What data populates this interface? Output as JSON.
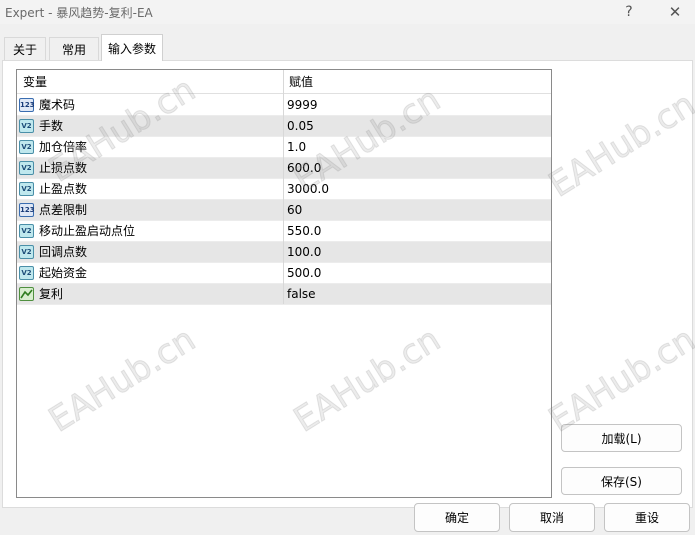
{
  "window": {
    "title": "Expert - 暴风趋势-复利-EA",
    "help": "?",
    "close": "✕"
  },
  "tabs": [
    {
      "label": "关于",
      "active": false
    },
    {
      "label": "常用",
      "active": false
    },
    {
      "label": "输入参数",
      "active": true
    }
  ],
  "grid": {
    "col_variable": "变量",
    "col_value": "赋值",
    "rows": [
      {
        "icon": "int-icon",
        "icon_text": "123",
        "name": "魔术码",
        "value": "9999"
      },
      {
        "icon": "double-icon",
        "icon_text": "V2",
        "name": "手数",
        "value": "0.05"
      },
      {
        "icon": "double-icon",
        "icon_text": "V2",
        "name": "加仓倍率",
        "value": "1.0"
      },
      {
        "icon": "double-icon",
        "icon_text": "V2",
        "name": "止损点数",
        "value": "600.0"
      },
      {
        "icon": "double-icon",
        "icon_text": "V2",
        "name": "止盈点数",
        "value": "3000.0"
      },
      {
        "icon": "int-icon",
        "icon_text": "123",
        "name": "点差限制",
        "value": "60"
      },
      {
        "icon": "double-icon",
        "icon_text": "V2",
        "name": "移动止盈启动点位",
        "value": "550.0"
      },
      {
        "icon": "double-icon",
        "icon_text": "V2",
        "name": "回调点数",
        "value": "100.0"
      },
      {
        "icon": "double-icon",
        "icon_text": "V2",
        "name": "起始资金",
        "value": "500.0"
      },
      {
        "icon": "bool-icon",
        "icon_text": "",
        "name": "复利",
        "value": "false"
      }
    ]
  },
  "buttons": {
    "load": "加载(L)",
    "save": "保存(S)",
    "ok": "确定",
    "cancel": "取消",
    "reset": "重设"
  },
  "watermark": "EAHub.cn"
}
